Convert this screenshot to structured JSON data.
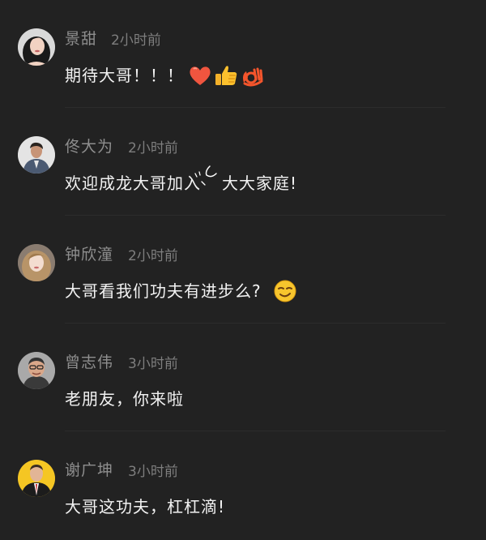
{
  "comments": [
    {
      "user": "景甜",
      "time": "2小时前",
      "text": "期待大哥！！！",
      "avatar_icon": "avatar-woman-dark-hair",
      "emojis": [
        "heart-emoji",
        "thumbs-up-emoji",
        "ok-hand-emoji"
      ]
    },
    {
      "user": "佟大为",
      "time": "2小时前",
      "text": "欢迎成龙大哥加入",
      "text_suffix": "大大家庭!",
      "avatar_icon": "avatar-man-suit",
      "emojis": []
    },
    {
      "user": "钟欣潼",
      "time": "2小时前",
      "text": "大哥看我们功夫有进步么?",
      "avatar_icon": "avatar-woman-light-hair",
      "emojis": [
        "smirk-emoji"
      ]
    },
    {
      "user": "曾志伟",
      "time": "3小时前",
      "text": "老朋友，你来啦",
      "avatar_icon": "avatar-man-glasses",
      "emojis": []
    },
    {
      "user": "谢广坤",
      "time": "3小时前",
      "text": "大哥这功夫，杠杠滴!",
      "avatar_icon": "avatar-man-yellow-background",
      "emojis": []
    }
  ],
  "colors": {
    "background": "#222222",
    "username": "#8e8e8e",
    "timestamp": "#7e7e7e",
    "comment_text": "#f2f2f2",
    "divider": "#2c2c2c"
  }
}
